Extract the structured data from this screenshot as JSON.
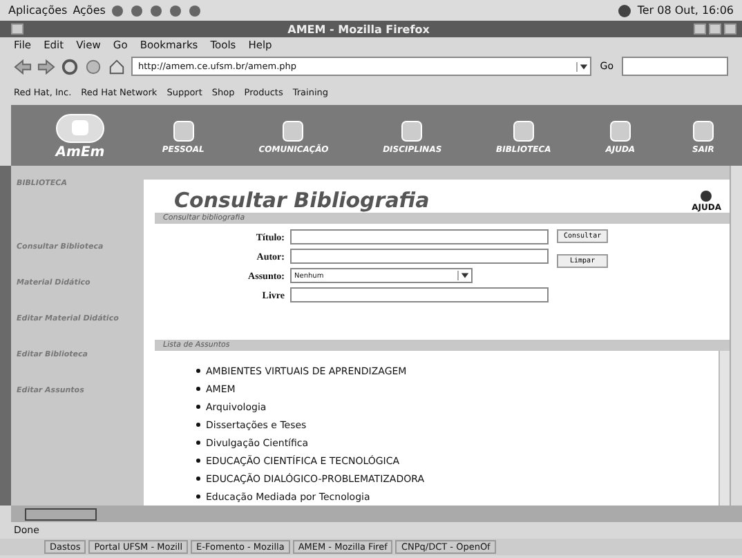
{
  "panel": {
    "menus": [
      "Aplicações",
      "Ações"
    ],
    "clock": "Ter 08 Out, 16:06"
  },
  "window": {
    "title": "AMEM - Mozilla Firefox"
  },
  "menu_bar": [
    "File",
    "Edit",
    "View",
    "Go",
    "Bookmarks",
    "Tools",
    "Help"
  ],
  "address_bar": {
    "value": "http://amem.ce.ufsm.br/amem.php",
    "go": "Go"
  },
  "bookmarks": [
    "Red Hat, Inc.",
    "Red Hat Network",
    "Support",
    "Shop",
    "Products",
    "Training"
  ],
  "site": {
    "logo": "AmEm",
    "nav": [
      {
        "label": "PESSOAL"
      },
      {
        "label": "COMUNICAÇÃO"
      },
      {
        "label": "DISCIPLINAS"
      },
      {
        "label": "BIBLIOTECA"
      },
      {
        "label": "AJUDA"
      },
      {
        "label": "SAIR"
      }
    ]
  },
  "sidebar": {
    "title": "BIBLIOTECA",
    "items": [
      "Consultar Biblioteca",
      "Material Didático",
      "Editar Material Didático",
      "Editar Biblioteca",
      "Editar Assuntos"
    ]
  },
  "page": {
    "heading": "Consultar Bibliografia",
    "help": "AJUDA",
    "section": "Consultar bibliografia",
    "fields": [
      {
        "label": "Título:",
        "kind": "text"
      },
      {
        "label": "Autor:",
        "kind": "text"
      },
      {
        "label": "Assunto:",
        "kind": "select",
        "value": "Nenhum"
      },
      {
        "label": "Livre",
        "kind": "text"
      }
    ],
    "buttons": [
      "Consultar",
      "Limpar"
    ],
    "list_title": "Lista de Assuntos",
    "subjects": [
      "AMBIENTES VIRTUAIS DE APRENDIZAGEM",
      "AMEM",
      "Arquivologia",
      "Dissertações e Teses",
      "Divulgação Científica",
      "EDUCAÇÃO CIENTÍFICA E TECNOLÓGICA",
      "EDUCAÇÃO DIALÓGICO-PROBLEMATIZADORA",
      "Educação Mediada por Tecnologia"
    ]
  },
  "status_bar": "Done",
  "taskbar": [
    "Dastos",
    "Portal UFSM - Mozill",
    "E-Fomento - Mozilla",
    "AMEM - Mozilla Firef",
    "CNPq/DCT - OpenOf"
  ]
}
